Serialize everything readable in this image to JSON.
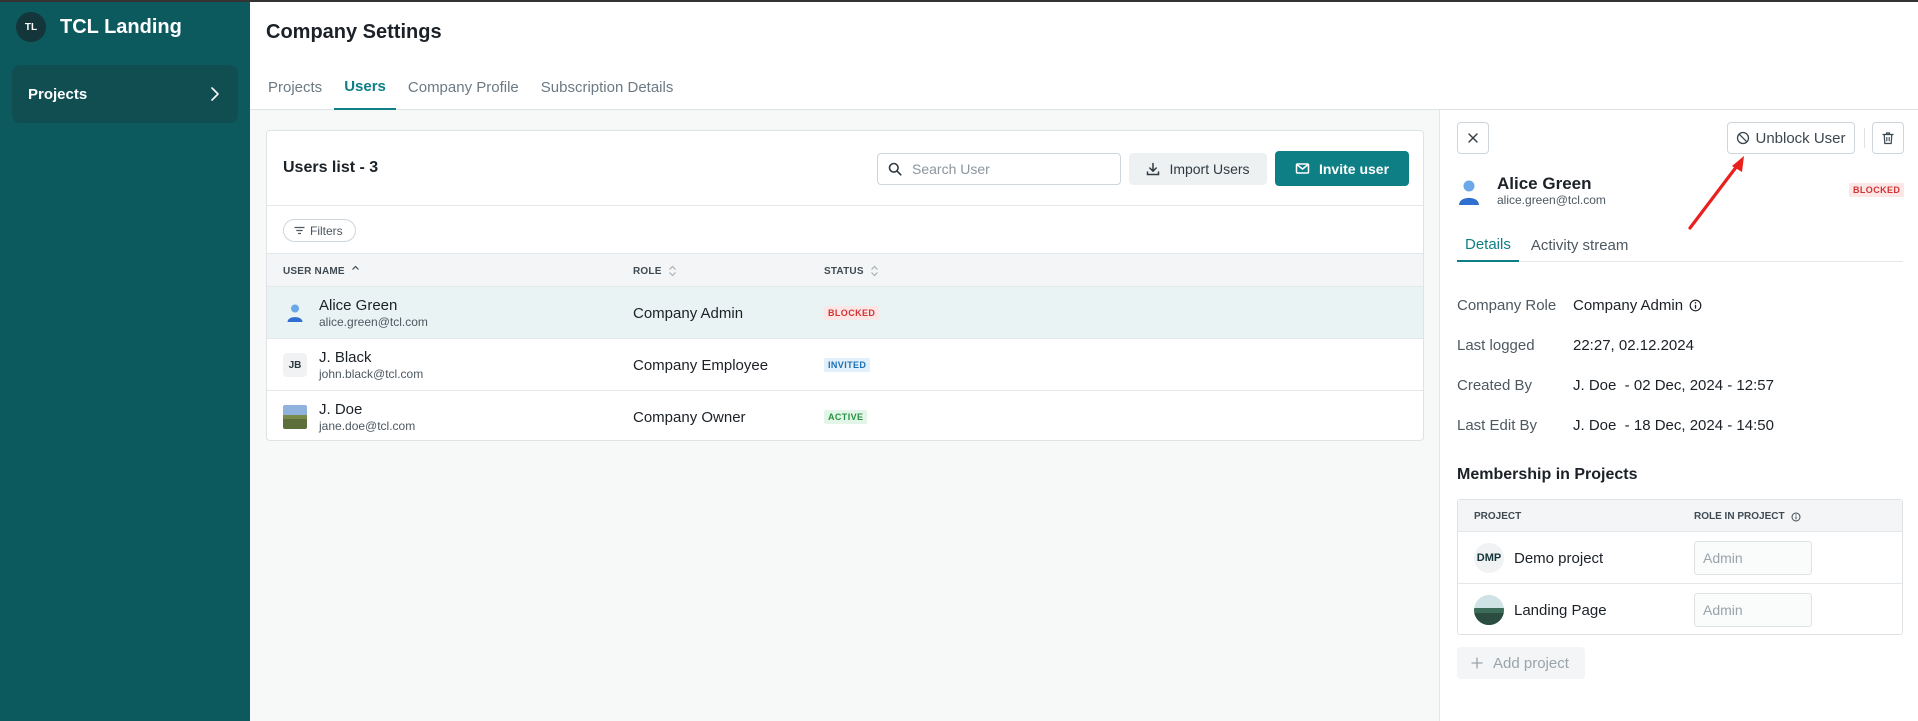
{
  "sidebar": {
    "brand_initials": "TL",
    "brand_title": "TCL Landing",
    "nav_items": [
      {
        "label": "Projects"
      }
    ]
  },
  "header": {
    "title": "Company Settings",
    "tabs": [
      {
        "label": "Projects",
        "active": false
      },
      {
        "label": "Users",
        "active": true
      },
      {
        "label": "Company Profile",
        "active": false
      },
      {
        "label": "Subscription Details",
        "active": false
      }
    ]
  },
  "users": {
    "list_title": "Users list - 3",
    "search_placeholder": "Search User",
    "import_label": "Import Users",
    "invite_label": "Invite user",
    "filters_label": "Filters",
    "columns": {
      "name": "USER NAME",
      "role": "ROLE",
      "status": "STATUS"
    },
    "rows": [
      {
        "name": "Alice Green",
        "email": "alice.green@tcl.com",
        "role": "Company Admin",
        "status": "BLOCKED",
        "avatar": "person-icon",
        "selected": true
      },
      {
        "name": "J. Black",
        "email": "john.black@tcl.com",
        "role": "Company Employee",
        "status": "INVITED",
        "initials": "JB",
        "selected": false
      },
      {
        "name": "J. Doe",
        "email": "jane.doe@tcl.com",
        "role": "Company Owner",
        "status": "ACTIVE",
        "avatar": "landscape-photo",
        "selected": false
      }
    ]
  },
  "detail": {
    "unblock_label": "Unblock User",
    "name": "Alice Green",
    "email": "alice.green@tcl.com",
    "status": "BLOCKED",
    "tabs": [
      {
        "label": "Details",
        "active": true
      },
      {
        "label": "Activity stream",
        "active": false
      }
    ],
    "info": [
      {
        "label": "Company Role",
        "value": "Company Admin"
      },
      {
        "label": "Last logged",
        "value": "22:27, 02.12.2024"
      },
      {
        "label": "Created By",
        "value": "J. Doe  - 02 Dec, 2024 - 12:57"
      },
      {
        "label": "Last Edit By",
        "value": "J. Doe  - 18 Dec, 2024 - 14:50"
      }
    ],
    "membership_title": "Membership in Projects",
    "membership_columns": {
      "project": "PROJECT",
      "role": "ROLE IN PROJECT"
    },
    "projects": [
      {
        "name": "Demo project",
        "avatar_text": "DMP",
        "role_placeholder": "Admin"
      },
      {
        "name": "Landing Page",
        "avatar_text": "",
        "role_placeholder": "Admin"
      }
    ],
    "add_project_label": "Add project"
  },
  "colors": {
    "sidebar": "#0c5a5e",
    "accent": "#0f7f86",
    "blocked": "#d23434",
    "invited": "#1c6fb2",
    "active": "#25933f",
    "annotation_arrow": "#e8211f"
  }
}
